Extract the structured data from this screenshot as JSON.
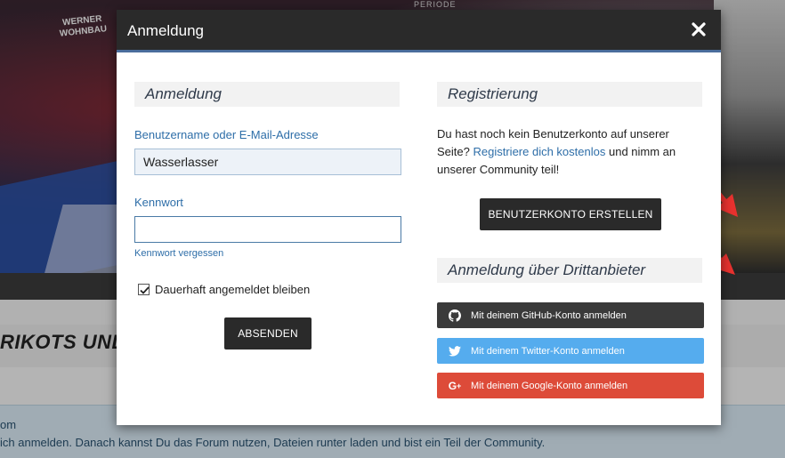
{
  "background": {
    "banner_top_text": "PERIODE",
    "jersey_text": "WERNER WOHNBAU",
    "heading": "RIKOTS UND I",
    "info_line1": "om",
    "info_line2": "ich anmelden. Danach kannst Du das Forum nutzen, Dateien runter laden und bist ein Teil der Community."
  },
  "modal": {
    "title": "Anmeldung",
    "close_icon": "close-icon",
    "login": {
      "section_title": "Anmeldung",
      "username_label": "Benutzername oder E-Mail-Adresse",
      "username_value": "Wasserlasser",
      "password_label": "Kennwort",
      "password_value": "",
      "forgot_link": "Kennwort vergessen",
      "remember_label": "Dauerhaft angemeldet bleiben",
      "remember_checked": true,
      "submit_label": "ABSENDEN"
    },
    "register": {
      "section_title": "Registrierung",
      "text_before": "Du hast noch kein Benutzerkonto auf unserer Seite?",
      "link_text": "Registriere dich kostenlos",
      "text_after": "und nimm an unserer Community teil!",
      "create_button": "BENUTZERKONTO ERSTELLEN"
    },
    "third_party": {
      "section_title": "Anmeldung über Drittanbieter",
      "buttons": [
        {
          "label": "Mit deinem GitHub-Konto anmelden",
          "icon": "github-icon",
          "color": "#3a3a3a"
        },
        {
          "label": "Mit deinem Twitter-Konto anmelden",
          "icon": "twitter-icon",
          "color": "#55acee"
        },
        {
          "label": "Mit deinem Google-Konto anmelden",
          "icon": "google-plus-icon",
          "color": "#dd4b39"
        }
      ]
    }
  },
  "colors": {
    "header_bg": "#2a2a2a",
    "header_accent": "#4a6d9c",
    "link": "#2e6ea8",
    "annotation_arrow": "#e8322f"
  }
}
